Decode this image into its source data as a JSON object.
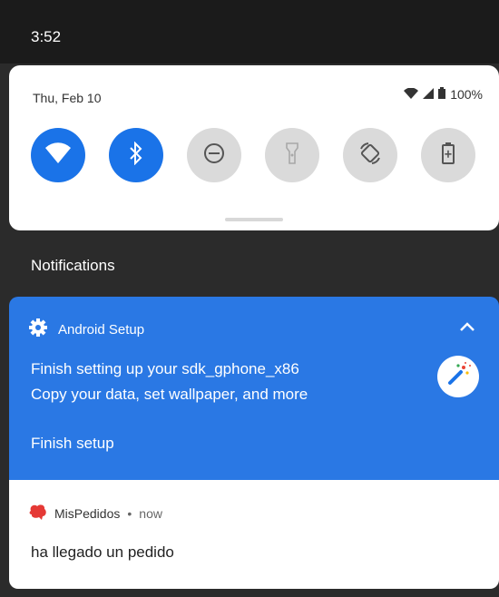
{
  "status_bar": {
    "time": "3:52"
  },
  "quick_settings": {
    "date": "Thu, Feb 10",
    "battery_percent": "100%",
    "tiles": [
      {
        "name": "wifi",
        "icon": "wifi-icon",
        "state": "on"
      },
      {
        "name": "bluetooth",
        "icon": "bluetooth-icon",
        "state": "on"
      },
      {
        "name": "do-not-disturb",
        "icon": "do-not-disturb-icon",
        "state": "off"
      },
      {
        "name": "flashlight",
        "icon": "flashlight-icon",
        "state": "off"
      },
      {
        "name": "auto-rotate",
        "icon": "auto-rotate-icon",
        "state": "off"
      },
      {
        "name": "battery-saver",
        "icon": "battery-saver-icon",
        "state": "off"
      }
    ]
  },
  "notifications": {
    "header": "Notifications",
    "items": [
      {
        "app_name": "Android Setup",
        "app_icon": "gear-icon",
        "title": "Finish setting up your sdk_gphone_x86",
        "text": "Copy your data, set wallpaper, and more",
        "action": "Finish setup",
        "avatar_icon": "magic-wand-icon",
        "expanded": true,
        "accent_color": "#2a78e4"
      },
      {
        "app_name": "MisPedidos",
        "app_icon": "app-icon-red",
        "time": "now",
        "text": "ha llegado un pedido",
        "accent_color": "#e53935"
      }
    ]
  },
  "colors": {
    "tile_on": "#1a73e8",
    "tile_off": "#dadada",
    "shade_background": "#2b2b2b"
  }
}
